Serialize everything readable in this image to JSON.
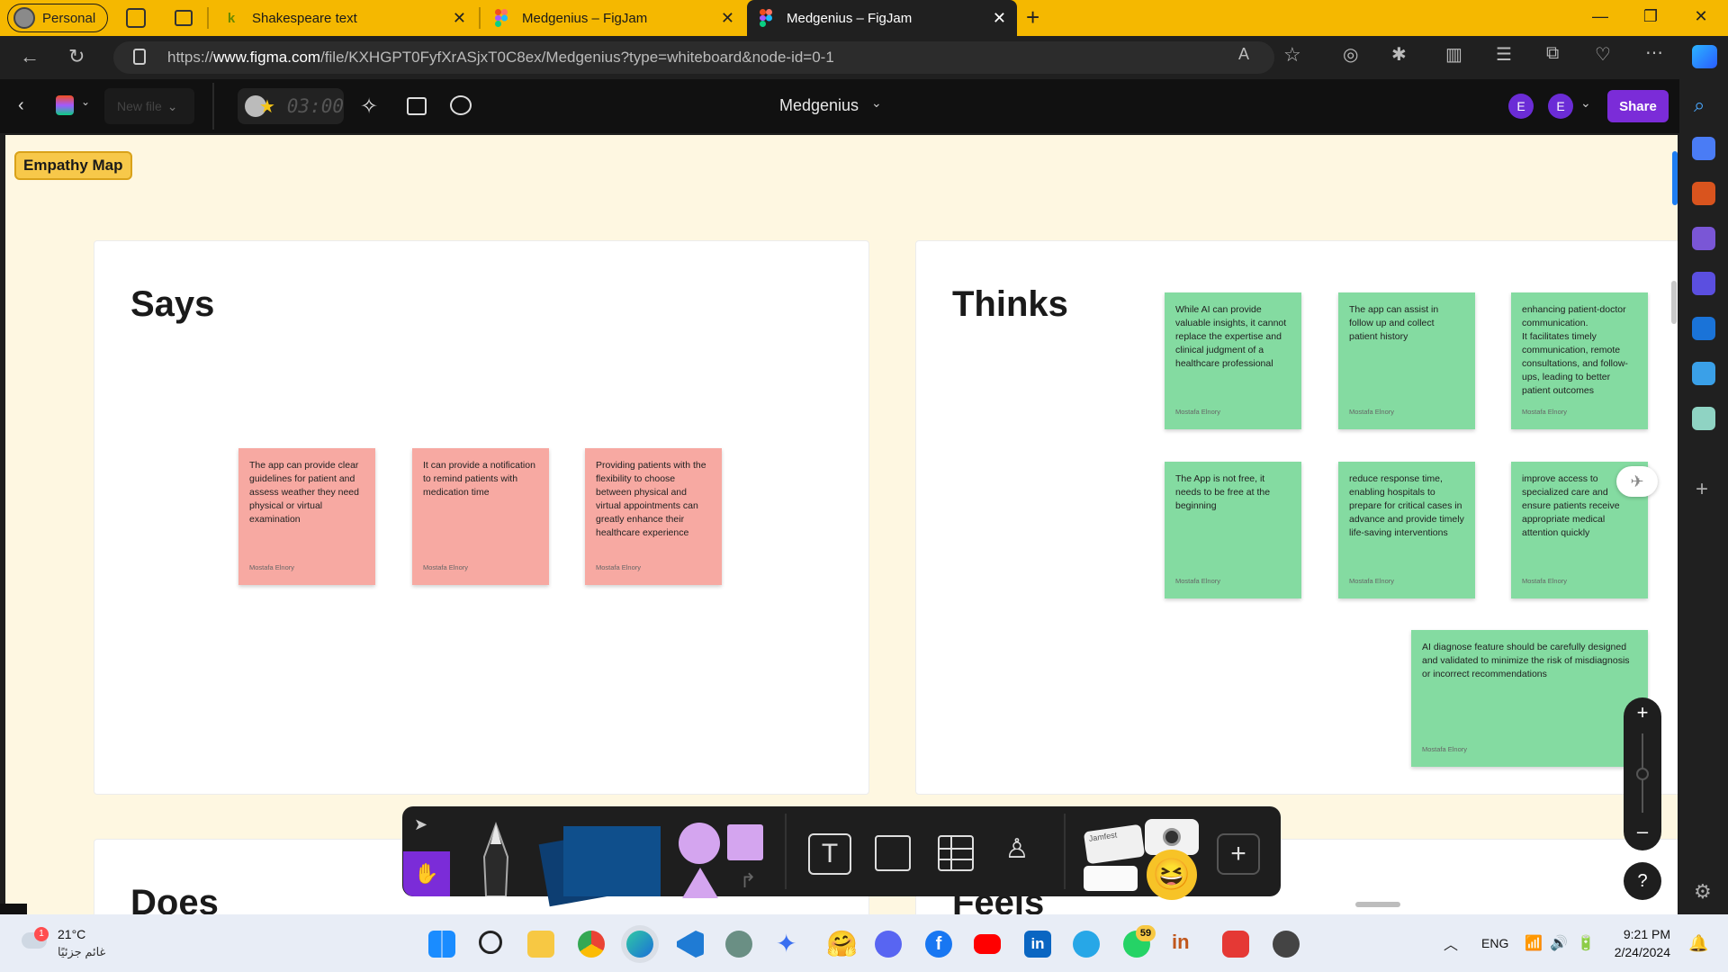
{
  "browser": {
    "profile": "Personal",
    "tabs": [
      {
        "title": "Shakespeare text",
        "icon": "k"
      },
      {
        "title": "Medgenius – FigJam",
        "icon": "figma"
      },
      {
        "title": "Medgenius – FigJam",
        "icon": "figma",
        "active": true
      }
    ],
    "url_prefix": "https://",
    "url_domain": "www.figma.com",
    "url_rest": "/file/KXHGPT0FyfXrASjxT0C8ex/Medgenius?type=whiteboard&node-id=0-1"
  },
  "figjam": {
    "file_menu": "New file",
    "timer": "03:00",
    "file_title": "Medgenius",
    "user_initials": [
      "E",
      "E"
    ],
    "share_label": "Share",
    "section_label": "Empathy Map"
  },
  "frames": {
    "says": {
      "title": "Says"
    },
    "thinks": {
      "title": "Thinks"
    },
    "does": {
      "title": "Does"
    },
    "feels": {
      "title": "Feels"
    }
  },
  "stickies": {
    "says": [
      {
        "text": "The app can provide clear guidelines for patient and assess weather they need physical or virtual examination",
        "author": "Mostafa Elnory"
      },
      {
        "text": "It can provide a notification to remind patients with medication time",
        "author": "Mostafa Elnory"
      },
      {
        "text": "Providing patients with the flexibility to choose between physical and virtual appointments can greatly enhance their healthcare experience",
        "author": "Mostafa Elnory"
      }
    ],
    "thinks": [
      {
        "text": "While AI can provide valuable insights, it cannot replace the expertise and clinical judgment of a healthcare professional",
        "author": "Mostafa Elnory"
      },
      {
        "text": "The app can assist in follow up and collect patient history",
        "author": "Mostafa Elnory"
      },
      {
        "text": "enhancing patient-doctor communication.\nIt facilitates timely communication, remote consultations, and follow-ups, leading to better patient outcomes",
        "author": "Mostafa Elnory"
      },
      {
        "text": "The App is not free, it needs to be free at the beginning",
        "author": "Mostafa Elnory"
      },
      {
        "text": "reduce response time, enabling hospitals to prepare for critical cases in advance and provide timely life-saving interventions",
        "author": "Mostafa Elnory"
      },
      {
        "text": " improve access to specialized care and ensure patients receive appropriate medical attention quickly",
        "author": "Mostafa Elnory"
      },
      {
        "text": "AI diagnose feature should be carefully designed and validated to minimize the risk of misdiagnosis or incorrect recommendations",
        "author": "Mostafa Elnory"
      }
    ]
  },
  "toolbar": {
    "sticker_label": "Jamfest"
  },
  "zoom": {
    "plus": "+",
    "minus": "–",
    "help": "?"
  },
  "taskbar": {
    "weather_temp": "21°C",
    "weather_desc": "غائم جزئيًا",
    "weather_badge": "1",
    "whatsapp_badge": "59",
    "lang": "ENG",
    "time": "9:21 PM",
    "date": "2/24/2024"
  }
}
